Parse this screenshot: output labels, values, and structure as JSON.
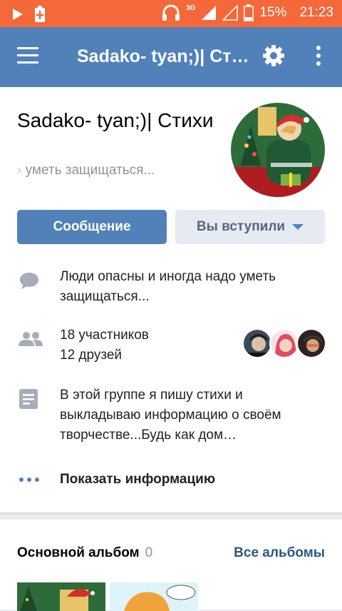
{
  "status_bar": {
    "battery": "15%",
    "time": "21:23",
    "network": "3G"
  },
  "header": {
    "title": "Sadako- tyan;)| Стихи"
  },
  "group": {
    "name": "Sadako- tyan;)| Стихи",
    "status": "уметь защищаться..."
  },
  "actions": {
    "message_label": "Сообщение",
    "joined_label": "Вы вступили"
  },
  "info": {
    "description_short": "Люди опасны и иногда надо уметь защищаться...",
    "members": "18 участников",
    "friends": "12 друзей",
    "about": "В этой группе я пишу стихи и выкладываю информацию о своём творчестве...Будь как дом…",
    "show_info": "Показать информацию"
  },
  "albums": {
    "title": "Основной альбом",
    "count": "0",
    "all_label": "Все альбомы"
  },
  "colors": {
    "status_bar": "#f4683a",
    "accent": "#5181b8",
    "link": "#2a5885"
  },
  "icons": [
    "play-icon",
    "battery-charge-icon",
    "headphones-icon",
    "signal-icon",
    "battery-icon",
    "menu-icon",
    "gear-icon",
    "more-vertical-icon",
    "comment-icon",
    "people-icon",
    "document-icon",
    "more-horizontal-icon"
  ]
}
